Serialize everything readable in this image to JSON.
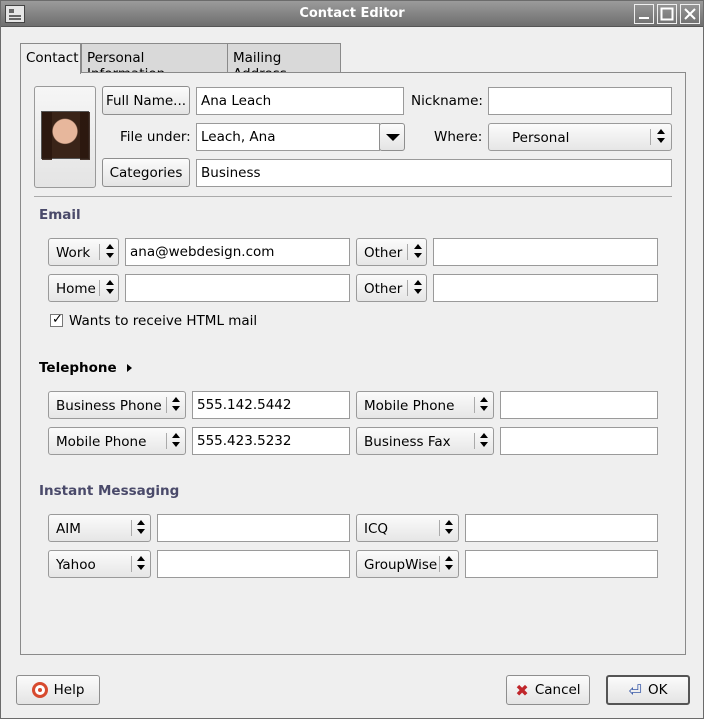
{
  "window": {
    "title": "Contact Editor"
  },
  "tabs": [
    {
      "label": "Contact",
      "active": true
    },
    {
      "label": "Personal Information",
      "active": false
    },
    {
      "label": "Mailing Address",
      "active": false
    }
  ],
  "identity": {
    "full_name_button": "Full Name...",
    "full_name_value": "Ana Leach",
    "nickname_label": "Nickname:",
    "nickname_value": "",
    "file_under_label": "File under:",
    "file_under_value": "Leach, Ana",
    "where_label": "Where:",
    "where_value": "Personal",
    "categories_button": "Categories",
    "categories_value": "Business"
  },
  "email": {
    "section_title": "Email",
    "rows": [
      {
        "left_type": "Work",
        "left_value": "ana@webdesign.com",
        "right_type": "Other",
        "right_value": ""
      },
      {
        "left_type": "Home",
        "left_value": "",
        "right_type": "Other",
        "right_value": ""
      }
    ],
    "html_mail_label": "Wants to receive HTML mail",
    "html_mail_checked": true
  },
  "telephone": {
    "section_title": "Telephone",
    "rows": [
      {
        "left_type": "Business Phone",
        "left_value": "555.142.5442",
        "right_type": "Mobile Phone",
        "right_value": ""
      },
      {
        "left_type": "Mobile Phone",
        "left_value": "555.423.5232",
        "right_type": "Business Fax",
        "right_value": ""
      }
    ]
  },
  "im": {
    "section_title": "Instant Messaging",
    "rows": [
      {
        "left_type": "AIM",
        "left_value": "",
        "right_type": "ICQ",
        "right_value": ""
      },
      {
        "left_type": "Yahoo",
        "left_value": "",
        "right_type": "GroupWise",
        "right_value": ""
      }
    ]
  },
  "footer": {
    "help_label": "Help",
    "cancel_label": "Cancel",
    "ok_label": "OK"
  }
}
